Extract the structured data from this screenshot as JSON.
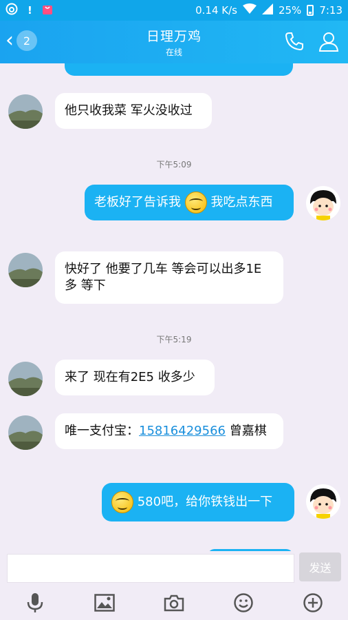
{
  "status_bar": {
    "network_speed": "0.14 K/s",
    "battery_percent": "25%",
    "time": "7:13"
  },
  "header": {
    "back_badge": "2",
    "title": "日理万鸡",
    "subtitle": "在线"
  },
  "messages": [
    {
      "from": "other",
      "text": "他只收我菜 军火没收过"
    },
    {
      "type": "time",
      "text": "下午5:09"
    },
    {
      "from": "me",
      "text_before": "老板好了告诉我",
      "text_after": "我吃点东西",
      "emoji": "smile-icon"
    },
    {
      "from": "other",
      "text": "快好了 他要了几车 等会可以出多1E多 等下"
    },
    {
      "type": "time",
      "text": "下午5:19"
    },
    {
      "from": "other",
      "text": "来了  现在有2E5 收多少"
    },
    {
      "from": "other",
      "text_before": "唯一支付宝：",
      "link": "15816429566",
      "text_after": "  曾嘉棋"
    },
    {
      "from": "me",
      "text_after": "580吧，给你铁钱出一下",
      "emoji": "smile-icon"
    }
  ],
  "input": {
    "placeholder": "",
    "send_label": "发送"
  },
  "colors": {
    "accent": "#1bb2f3",
    "background": "#f1ecf6"
  }
}
